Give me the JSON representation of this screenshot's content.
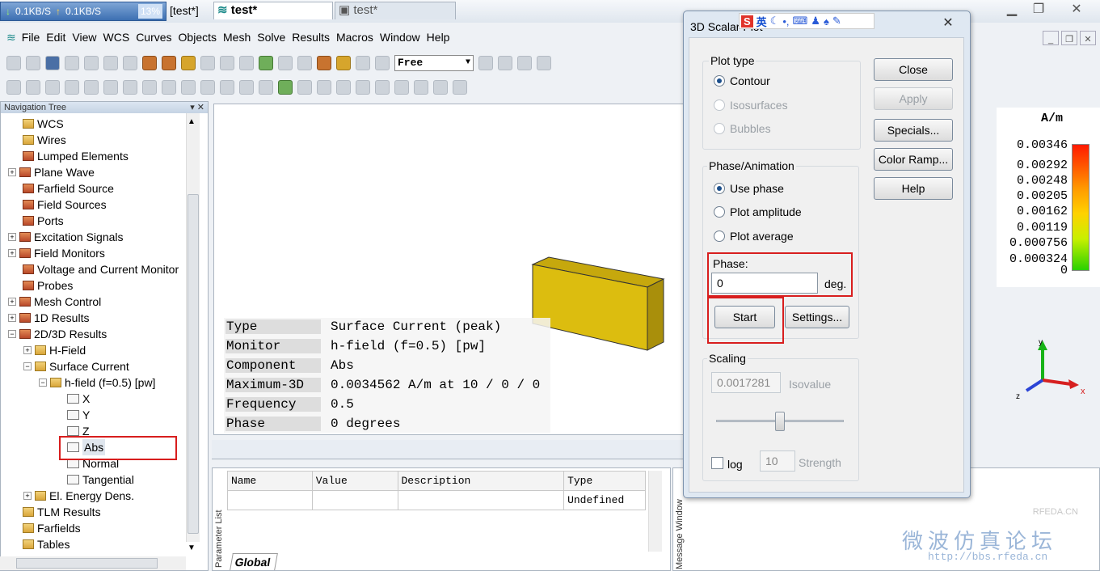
{
  "window": {
    "title": "[test*]",
    "net_down": "0.1KB/S",
    "net_up": "0.1KB/S",
    "cpu_pct": "13%"
  },
  "menu": [
    "File",
    "Edit",
    "View",
    "WCS",
    "Curves",
    "Objects",
    "Mesh",
    "Solve",
    "Results",
    "Macros",
    "Window",
    "Help"
  ],
  "toolbar": {
    "mode_select": "Free"
  },
  "nav_tree": {
    "header": "Navigation Tree",
    "items": [
      "WCS",
      "Wires",
      "Lumped Elements",
      "Plane Wave",
      "Farfield Source",
      "Field Sources",
      "Ports",
      "Excitation Signals",
      "Field Monitors",
      "Voltage and Current Monitor",
      "Probes",
      "Mesh Control",
      "1D Results",
      "2D/3D Results",
      "H-Field",
      "Surface Current",
      "h-field (f=0.5) [pw]",
      "X",
      "Y",
      "Z",
      "Abs",
      "Normal",
      "Tangential",
      "El. Energy Dens.",
      "TLM Results",
      "Farfields",
      "Tables"
    ]
  },
  "info_table": {
    "rows": [
      {
        "key": "Type",
        "value": "Surface Current (peak)"
      },
      {
        "key": "Monitor",
        "value": "h-field (f=0.5) [pw]"
      },
      {
        "key": "Component",
        "value": "Abs"
      },
      {
        "key": "Maximum-3D",
        "value": "0.0034562 A/m at 10 / 0 / 0"
      },
      {
        "key": "Frequency",
        "value": "0.5"
      },
      {
        "key": "Phase",
        "value": "0 degrees"
      }
    ]
  },
  "doc_tabs": [
    "test*",
    "test*"
  ],
  "param_list": {
    "side_label": "Parameter List",
    "columns": [
      "Name",
      "Value",
      "Description",
      "Type"
    ],
    "row": [
      "",
      "",
      "",
      "Undefined"
    ],
    "tab": "Global"
  },
  "message_window": {
    "side_label": "Message Window"
  },
  "dialog": {
    "title": "3D Scalar Plot",
    "plot_type_label": "Plot type",
    "plot_types": [
      "Contour",
      "Isosurfaces",
      "Bubbles"
    ],
    "phase_anim_label": "Phase/Animation",
    "phase_options": [
      "Use phase",
      "Plot amplitude",
      "Plot average"
    ],
    "phase_label": "Phase:",
    "phase_value": "0",
    "phase_unit": "deg.",
    "start": "Start",
    "settings": "Settings...",
    "scaling_label": "Scaling",
    "isovalue": "0.0017281",
    "isovalue_label": "Isovalue",
    "log_label": "log",
    "strength_value": "10",
    "strength_label": "Strength",
    "buttons": [
      "Close",
      "Apply",
      "Specials...",
      "Color Ramp...",
      "Help"
    ]
  },
  "legend": {
    "unit": "A/m",
    "values": [
      "0.00346",
      "0.00292",
      "0.00248",
      "0.00205",
      "0.00162",
      "0.00119",
      "0.000756",
      "0.000324",
      "0"
    ]
  },
  "ime_text": "英",
  "watermark": {
    "line1": "微波仿真论坛",
    "line2": "http://bbs.rfeda.cn",
    "brand": "RFEDA.CN"
  },
  "colors": {
    "accent_red": "#d81e1e",
    "box_yellow": "#d9bb12",
    "ramp_top": "#ff1a00",
    "ramp_bottom": "#2ad100"
  }
}
